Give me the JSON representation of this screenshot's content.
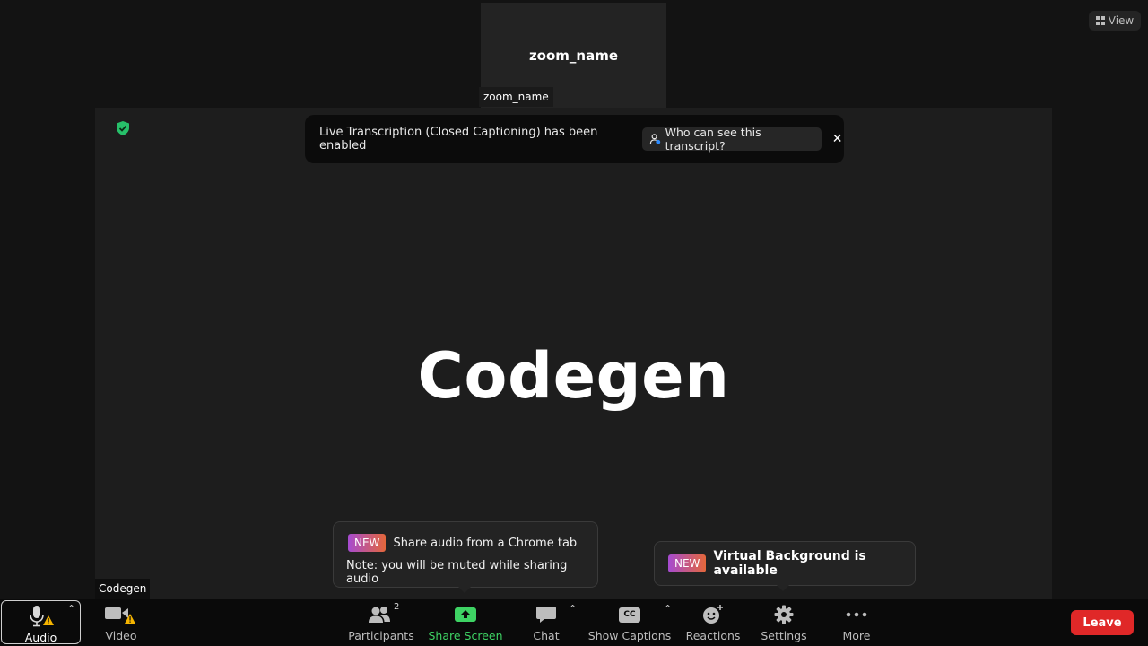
{
  "view_button": {
    "label": "View",
    "icon": "grid-view-icon"
  },
  "thumbnail": {
    "name": "zoom_name",
    "label": "zoom_name"
  },
  "main": {
    "speaker_name": "Codegen",
    "speaker_label": "Codegen",
    "security_icon": "shield-check-icon"
  },
  "banner": {
    "text": "Live Transcription (Closed Captioning) has been enabled",
    "who_label": "Who can see this transcript?",
    "close": "✕"
  },
  "tooltips": {
    "audio": {
      "badge": "NEW",
      "title": "Share audio from a Chrome tab",
      "note": "Note: you will be muted while sharing audio"
    },
    "virtual_background": {
      "badge": "NEW",
      "title": "Virtual Background is available"
    }
  },
  "toolbar": {
    "audio": "Audio",
    "video": "Video",
    "participants": "Participants",
    "participants_count": "2",
    "share_screen": "Share Screen",
    "chat": "Chat",
    "show_captions": "Show Captions",
    "captions_icon_text": "CC",
    "reactions": "Reactions",
    "settings": "Settings",
    "more": "More",
    "leave": "Leave",
    "caret": "⌃"
  },
  "colors": {
    "share_green": "#3ed364",
    "leave_red": "#e02828",
    "warning_yellow": "#f5b400",
    "shield_green": "#27c06a"
  }
}
